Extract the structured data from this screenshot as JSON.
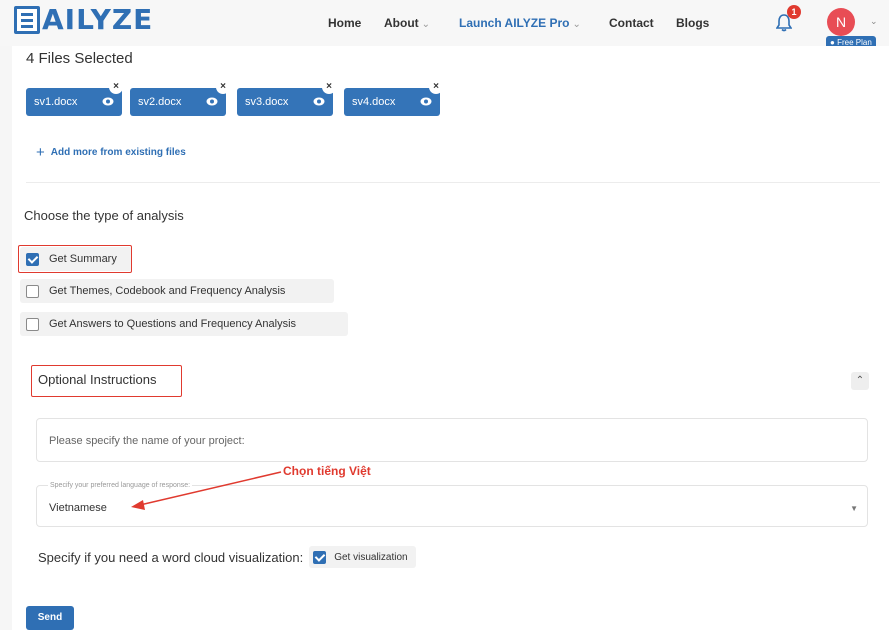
{
  "brand": {
    "logo_text": "AILYZE"
  },
  "nav": {
    "items": [
      {
        "label": "Home"
      },
      {
        "label": "About",
        "chevron": "⌄"
      },
      {
        "label": "Launch AILYZE Pro",
        "chevron": "⌄"
      },
      {
        "label": "Contact"
      },
      {
        "label": "Blogs"
      }
    ],
    "notification_count": "1",
    "avatar_initial": "N",
    "avatar_chevron": "⌄",
    "plan_badge": "Free Plan",
    "accent_color": "#2f6fb4",
    "avatar_color": "#e84d55"
  },
  "files": {
    "title": "4 Files Selected",
    "chips": [
      {
        "name": "sv1.docx"
      },
      {
        "name": "sv2.docx"
      },
      {
        "name": "sv3.docx"
      },
      {
        "name": "sv4.docx"
      }
    ],
    "remove_glyph": "×",
    "add_more_label": "Add more from existing files",
    "add_more_glyph": "+"
  },
  "analysis": {
    "title": "Choose the type of analysis",
    "options": [
      {
        "label": "Get Summary",
        "checked": true
      },
      {
        "label": "Get Themes, Codebook and Frequency Analysis",
        "checked": false
      },
      {
        "label": "Get Answers to Questions and Frequency Analysis",
        "checked": false
      }
    ]
  },
  "optional": {
    "title": "Optional Instructions",
    "collapse_glyph": "⌃",
    "project_placeholder": "Please specify the name of your project:",
    "language_label": "Specify your preferred language of response:",
    "language_value": "Vietnamese",
    "select_arrow": "▼",
    "annotation": "Chọn tiếng Việt",
    "wordcloud_label": "Specify if you need a word cloud visualization:",
    "wordcloud_option": "Get visualization",
    "wordcloud_checked": true
  },
  "actions": {
    "send_label": "Send"
  },
  "colors": {
    "highlight": "#e03a2f"
  }
}
